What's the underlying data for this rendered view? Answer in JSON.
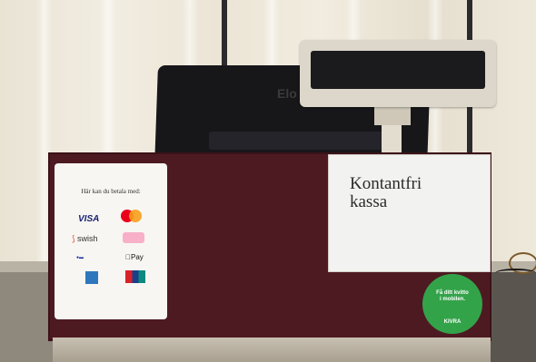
{
  "photo": {
    "sign_left": {
      "title": "Här kan du betala med:",
      "payments": [
        "VISA",
        "swish",
        "Pay"
      ]
    },
    "sign_right": {
      "line1": "Kontantfri",
      "line2": "kassa"
    },
    "monitor": {
      "brand": "Elo"
    },
    "sticker": {
      "line1": "Få ditt kvitto",
      "line2": "i mobilen.",
      "brand": "KIVRA"
    }
  }
}
